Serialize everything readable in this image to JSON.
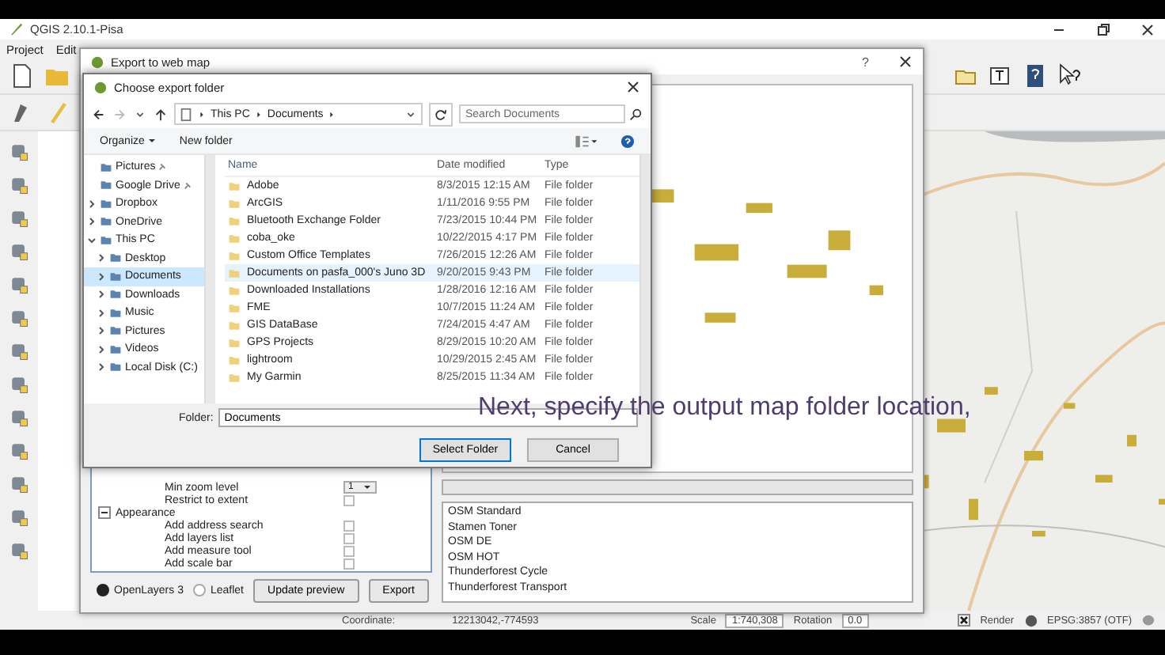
{
  "app_window": {
    "title": "QGIS 2.10.1-Pisa",
    "menu": [
      "Project",
      "Edit"
    ]
  },
  "export_dialog": {
    "title": "Export to web map",
    "help": "?",
    "settings": [
      {
        "label": "Min zoom level",
        "kind": "combo",
        "value": "1"
      },
      {
        "label": "Restrict to extent",
        "kind": "check",
        "checked": false
      },
      {
        "label": "Appearance",
        "kind": "group",
        "expanded": true,
        "children": [
          {
            "label": "Add address search",
            "kind": "check",
            "checked": false
          },
          {
            "label": "Add layers list",
            "kind": "check",
            "checked": false
          },
          {
            "label": "Add measure tool",
            "kind": "check",
            "checked": false
          },
          {
            "label": "Add scale bar",
            "kind": "check",
            "checked": false
          }
        ]
      }
    ],
    "renderers": [
      {
        "label": "OpenLayers 3",
        "selected": true
      },
      {
        "label": "Leaflet",
        "selected": false
      }
    ],
    "buttons": [
      "Update preview",
      "Export"
    ],
    "basemaps": [
      "OSM Standard",
      "Stamen Toner",
      "OSM DE",
      "OSM HOT",
      "Thunderforest Cycle",
      "Thunderforest Transport"
    ]
  },
  "folder_dialog": {
    "title": "Choose export folder",
    "path": [
      "This PC",
      "Documents"
    ],
    "search": {
      "placeholder": "Search Documents"
    },
    "toolbar": [
      "Organize",
      "New folder"
    ],
    "nav": [
      {
        "label": "Pictures",
        "pinned": true,
        "selected": false
      },
      {
        "label": "Google Drive",
        "pinned": true,
        "selected": false
      },
      {
        "label": "Dropbox",
        "expanded": false,
        "selected": false
      },
      {
        "label": "OneDrive",
        "expanded": false,
        "selected": false
      },
      {
        "label": "This PC",
        "expanded": true,
        "selected": false,
        "children": [
          {
            "label": "Desktop",
            "expanded": false,
            "selected": false
          },
          {
            "label": "Documents",
            "expanded": false,
            "selected": true
          },
          {
            "label": "Downloads",
            "expanded": false,
            "selected": false
          },
          {
            "label": "Music",
            "expanded": false,
            "selected": false
          },
          {
            "label": "Pictures",
            "expanded": false,
            "selected": false
          },
          {
            "label": "Videos",
            "expanded": false,
            "selected": false
          },
          {
            "label": "Local Disk (C:)",
            "expanded": false,
            "selected": false
          }
        ]
      }
    ],
    "columns": [
      "Name",
      "Date modified",
      "Type"
    ],
    "rows": [
      {
        "name": "Adobe",
        "date": "8/3/2015 12:15 AM",
        "type": "File folder",
        "selected": false
      },
      {
        "name": "ArcGIS",
        "date": "1/11/2016 9:55 PM",
        "type": "File folder",
        "selected": false
      },
      {
        "name": "Bluetooth Exchange Folder",
        "date": "7/23/2015 10:44 PM",
        "type": "File folder",
        "selected": false
      },
      {
        "name": "coba_oke",
        "date": "10/22/2015 4:17 PM",
        "type": "File folder",
        "selected": false
      },
      {
        "name": "Custom Office Templates",
        "date": "7/26/2015 12:26 AM",
        "type": "File folder",
        "selected": false
      },
      {
        "name": "Documents on pasfa_000's Juno 3D",
        "date": "9/20/2015 9:43 PM",
        "type": "File folder",
        "selected": true
      },
      {
        "name": "Downloaded Installations",
        "date": "1/28/2016 12:16 AM",
        "type": "File folder",
        "selected": false
      },
      {
        "name": "FME",
        "date": "10/7/2015 11:24 AM",
        "type": "File folder",
        "selected": false
      },
      {
        "name": "GIS DataBase",
        "date": "7/24/2015 4:47 AM",
        "type": "File folder",
        "selected": false
      },
      {
        "name": "GPS Projects",
        "date": "8/29/2015 10:20 AM",
        "type": "File folder",
        "selected": false
      },
      {
        "name": "lightroom",
        "date": "10/29/2015 2:45 AM",
        "type": "File folder",
        "selected": false
      },
      {
        "name": "My Garmin",
        "date": "8/25/2015 11:34 AM",
        "type": "File folder",
        "selected": false
      }
    ],
    "folder": {
      "label": "Folder:",
      "value": "Documents"
    },
    "buttons": [
      "Select Folder",
      "Cancel"
    ]
  },
  "caption": "Next, specify the output map folder location,",
  "status_bar": {
    "coordinate_label": "Coordinate:",
    "coordinate": "12213042,-774593",
    "scale_label": "Scale",
    "scale": "1:740,308",
    "rotation_label": "Rotation",
    "rotation": "0.0",
    "render_label": "Render",
    "render": true,
    "crs": "EPSG:3857 (OTF)"
  }
}
